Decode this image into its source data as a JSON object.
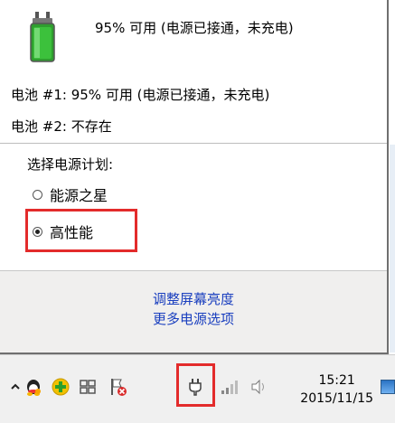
{
  "flyout": {
    "summary": "95% 可用 (电源已接通，未充电)",
    "batteries": [
      {
        "label": "电池 #1:",
        "status": "95% 可用 (电源已接通，未充电)"
      },
      {
        "label": "电池 #2:",
        "status": "不存在"
      }
    ],
    "plan_title": "选择电源计划:",
    "plans": [
      {
        "label": "能源之星",
        "selected": false
      },
      {
        "label": "高性能",
        "selected": true
      }
    ],
    "links": {
      "brightness": "调整屏幕亮度",
      "more_options": "更多电源选项"
    }
  },
  "taskbar": {
    "time": "15:21",
    "date": "2015/11/15",
    "icons": [
      "chevron-up-icon",
      "qq-icon",
      "plus-icon",
      "windows-flag-icon",
      "action-center-error-icon",
      "power-plug-icon",
      "network-bars-icon",
      "speaker-icon",
      "show-desktop-icon"
    ]
  },
  "colors": {
    "highlight_red": "#e32b2b",
    "link_blue": "#1a3fbf",
    "battery_green": "#3cc13c"
  }
}
